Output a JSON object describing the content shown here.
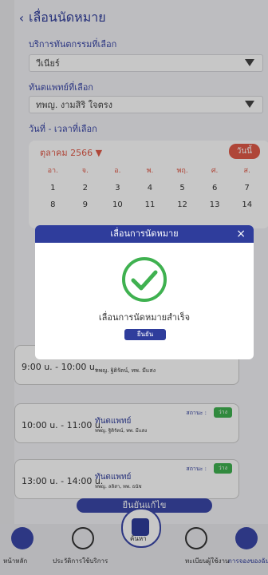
{
  "header": {
    "title": "เลื่อนนัดหมาย"
  },
  "labels": {
    "service": "บริการทันตกรรมที่เลือก",
    "dentist": "ทันตแพทย์ที่เลือก",
    "datetime": "วันที่ - เวลาที่เลือก"
  },
  "selects": {
    "service_value": "วีเนียร์",
    "dentist_value": "ทพญ. งามสิริ ใจตรง"
  },
  "calendar": {
    "month": "ตุลาคม 2566",
    "today_button": "วันนี้",
    "days": [
      "อา.",
      "จ.",
      "อ.",
      "พ.",
      "พฤ.",
      "ศ.",
      "ส."
    ],
    "week1": [
      "1",
      "2",
      "3",
      "4",
      "5",
      "6",
      "7"
    ],
    "week2": [
      "8",
      "9",
      "10",
      "11",
      "12",
      "13",
      "14"
    ]
  },
  "slots": [
    {
      "time": "9:00 u. - 10:00 u.",
      "docs": "ทพญ. ฐิติรัตน์, ทพ. มีแสง"
    },
    {
      "time": "10:00 u. - 11:00 u.",
      "kind": "ทันตแพทย์",
      "docs": "ทพญ. ฐิติรัตน์, ทพ. มีแสง",
      "status_label": "สถานะ :",
      "status_value": "ว่าง"
    },
    {
      "time": "13:00 u. - 14:00 u.",
      "kind": "ทันตแพทย์",
      "docs": "ทพญ. ลลิสา, ทพ. ธนัช",
      "status_label": "สถานะ :",
      "status_value": "ว่าง"
    }
  ],
  "confirm_button": "ยืนยันแก้ไข",
  "nav": {
    "home": "หน้าหลัก",
    "history": "ประวัติการใช้บริการ",
    "booking": "ค้นหา",
    "users": "ทะเบียนผู้ใช้งาน",
    "appointments": "การจองของฉัน"
  },
  "modal": {
    "title": "เลื่อนการนัดหมาย",
    "close": "×",
    "message": "เลื่อนการนัดหมายสำเร็จ",
    "ok": "ยืนยัน"
  },
  "colors": {
    "primary": "#2f3d9c",
    "accent": "#e05a48",
    "success": "#3fb150"
  }
}
